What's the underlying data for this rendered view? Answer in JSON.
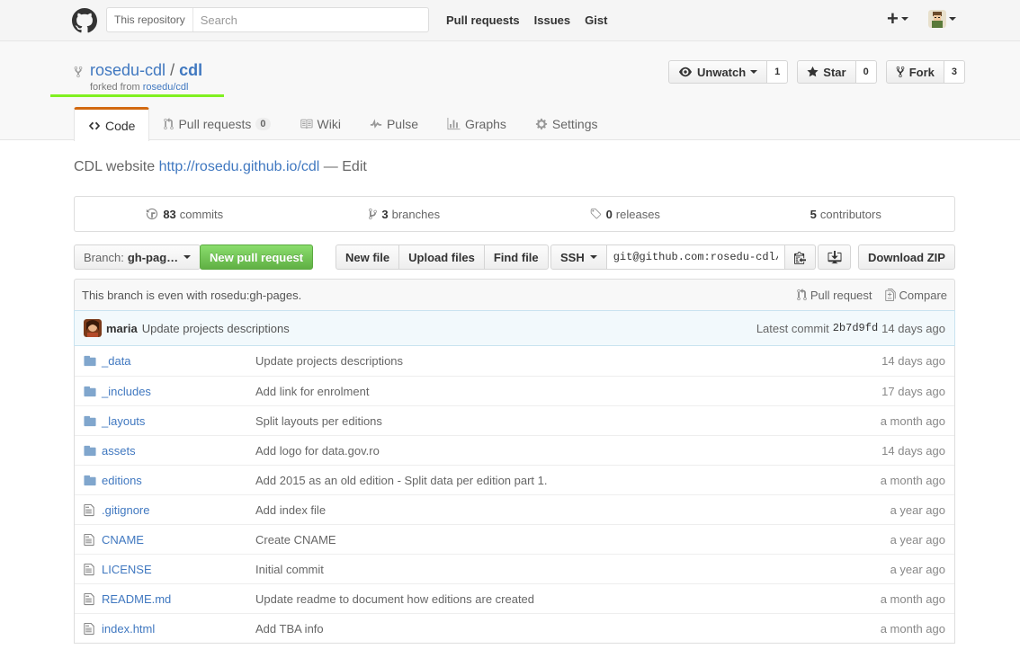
{
  "header": {
    "search_scope": "This repository",
    "search_placeholder": "Search",
    "nav": [
      "Pull requests",
      "Issues",
      "Gist"
    ],
    "plus_label": "+"
  },
  "repo": {
    "owner": "rosedu-cdl",
    "separator": "/",
    "name": "cdl",
    "forked_from_prefix": "forked from ",
    "forked_from": "rosedu/cdl",
    "actions": {
      "watch_label": "Unwatch",
      "watch_count": "1",
      "star_label": "Star",
      "star_count": "0",
      "fork_label": "Fork",
      "fork_count": "3"
    },
    "tabs": {
      "code": "Code",
      "pull_requests": "Pull requests",
      "pull_requests_count": "0",
      "wiki": "Wiki",
      "pulse": "Pulse",
      "graphs": "Graphs",
      "settings": "Settings"
    }
  },
  "description": {
    "text": "CDL website",
    "url": "http://rosedu.github.io/cdl",
    "dash": "—",
    "edit": "Edit"
  },
  "summary": {
    "commits_count": "83",
    "commits_label": "commits",
    "branches_count": "3",
    "branches_label": "branches",
    "releases_count": "0",
    "releases_label": "releases",
    "contributors_count": "5",
    "contributors_label": "contributors"
  },
  "file_nav": {
    "branch_label": "Branch:",
    "branch_value": "gh-pag…",
    "new_pr": "New pull request",
    "new_file": "New file",
    "upload_files": "Upload files",
    "find_file": "Find file",
    "clone_protocol": "SSH",
    "clone_url": "git@github.com:rosedu-cdl/cdl.git",
    "download_zip": "Download ZIP"
  },
  "branch_info": {
    "text": "This branch is even with rosedu:gh-pages.",
    "pull_request": "Pull request",
    "compare": "Compare"
  },
  "latest_commit": {
    "author": "maria",
    "message": "Update projects descriptions",
    "label": "Latest commit",
    "sha": "2b7d9fd",
    "age": "14 days ago"
  },
  "files": [
    {
      "type": "dir",
      "name": "_data",
      "message": "Update projects descriptions",
      "age": "14 days ago"
    },
    {
      "type": "dir",
      "name": "_includes",
      "message": "Add link for enrolment",
      "age": "17 days ago"
    },
    {
      "type": "dir",
      "name": "_layouts",
      "message": "Split layouts per editions",
      "age": "a month ago"
    },
    {
      "type": "dir",
      "name": "assets",
      "message": "Add logo for data.gov.ro",
      "age": "14 days ago"
    },
    {
      "type": "dir",
      "name": "editions",
      "message": "Add 2015 as an old edition - Split data per edition part 1.",
      "age": "a month ago"
    },
    {
      "type": "file",
      "name": ".gitignore",
      "message": "Add index file",
      "age": "a year ago"
    },
    {
      "type": "file",
      "name": "CNAME",
      "message": "Create CNAME",
      "age": "a year ago"
    },
    {
      "type": "file",
      "name": "LICENSE",
      "message": "Initial commit",
      "age": "a year ago"
    },
    {
      "type": "file",
      "name": "README.md",
      "message": "Update readme to document how editions are created",
      "age": "a month ago"
    },
    {
      "type": "file",
      "name": "index.html",
      "message": "Add TBA info",
      "age": "a month ago"
    }
  ]
}
